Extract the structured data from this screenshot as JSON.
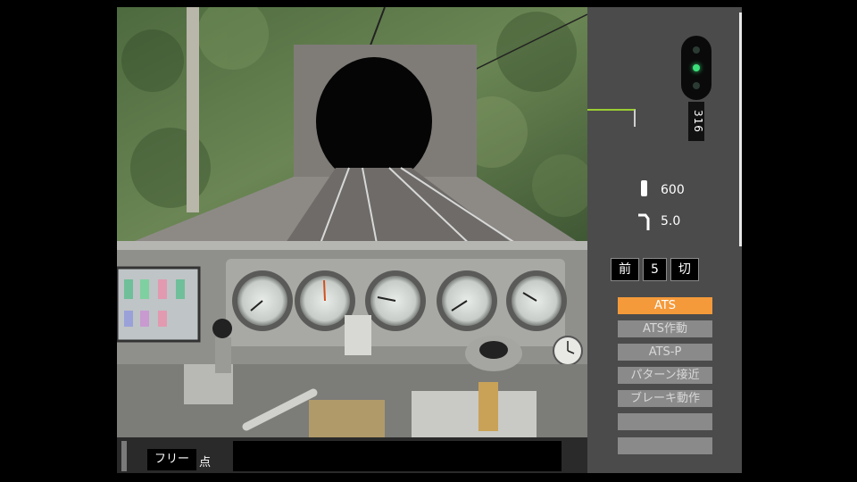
{
  "signal": {
    "label": "316",
    "lamps": [
      "off",
      "on",
      "off"
    ]
  },
  "limits": {
    "speed_limit": "600",
    "gradient": "5.0"
  },
  "reverser": {
    "direction": "前",
    "notch": "5",
    "power": "切"
  },
  "indicators": [
    {
      "label": "ATS",
      "state": "active"
    },
    {
      "label": "ATS作動",
      "state": "dim"
    },
    {
      "label": "ATS-P",
      "state": "dim"
    },
    {
      "label": "パターン接近",
      "state": "dim"
    },
    {
      "label": "ブレーキ動作",
      "state": "dim"
    },
    {
      "label": "",
      "state": "dim"
    },
    {
      "label": "",
      "state": "dim"
    }
  ],
  "status": {
    "mode": "フリー",
    "mode_sub": "点",
    "message": ""
  },
  "colors": {
    "panel": "#4b4b4b",
    "accent": "#f59a3a",
    "signal_green": "#3ce07a"
  }
}
